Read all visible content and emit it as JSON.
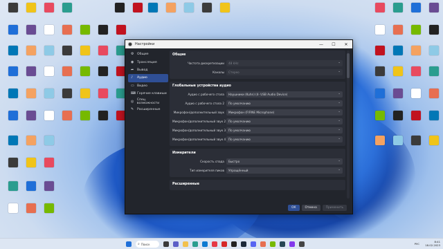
{
  "window": {
    "title": "Настройки",
    "controls": {
      "minimize": "—",
      "maximize": "☐",
      "close": "✕"
    }
  },
  "sidebar": {
    "items": [
      {
        "label": "Общие",
        "icon": "gear-icon",
        "active": false
      },
      {
        "label": "Трансляция",
        "icon": "broadcast-icon",
        "active": false
      },
      {
        "label": "Вывод",
        "icon": "output-icon",
        "active": false
      },
      {
        "label": "Аудио",
        "icon": "audio-icon",
        "active": true
      },
      {
        "label": "Видео",
        "icon": "video-icon",
        "active": false
      },
      {
        "label": "Горячие клавиши",
        "icon": "keyboard-icon",
        "active": false
      },
      {
        "label": "Спец. возможности",
        "icon": "accessibility-icon",
        "active": false
      },
      {
        "label": "Расширенные",
        "icon": "wrench-icon",
        "active": false
      }
    ]
  },
  "sections": {
    "general": {
      "title": "Общие",
      "rows": [
        {
          "label": "Частота дискретизации",
          "value": "48 kHz",
          "disabled": true
        },
        {
          "label": "Каналы",
          "value": "Стерео",
          "disabled": true
        }
      ]
    },
    "devices": {
      "title": "Глобальные устройства аудио",
      "rows": [
        {
          "label": "Аудио с рабочего стола",
          "value": "Наушники (Kuhn) (4- USB Audio Device)"
        },
        {
          "label": "Аудио с рабочего стола 2",
          "value": "По умолчанию"
        },
        {
          "label": "Микрофон/дополнительный звук",
          "value": "Микрофон (FIFINE Microphone)"
        },
        {
          "label": "Микрофон/дополнительный звук 2",
          "value": "По умолчанию"
        },
        {
          "label": "Микрофон/дополнительный звук 3",
          "value": "По умолчанию"
        },
        {
          "label": "Микрофон/дополнительный звук 4",
          "value": "По умолчанию"
        }
      ]
    },
    "meters": {
      "title": "Измерители",
      "rows": [
        {
          "label": "Скорость спада",
          "value": "Быстро"
        },
        {
          "label": "Тип измерителя пиков",
          "value": "Упрощённый"
        }
      ]
    },
    "advanced": {
      "title": "Расширенные"
    }
  },
  "footer": {
    "ok": "ОК",
    "cancel": "Отмена",
    "apply": "Применить"
  },
  "taskbar": {
    "search": "Поиск",
    "lang": "РУС",
    "time": "8:41",
    "date": "18.02.2023"
  },
  "colors": {
    "accent": "#2f4f95",
    "window_bg": "#22252c",
    "group_bg": "#2b2e37",
    "combo_bg": "#3b3e48"
  }
}
